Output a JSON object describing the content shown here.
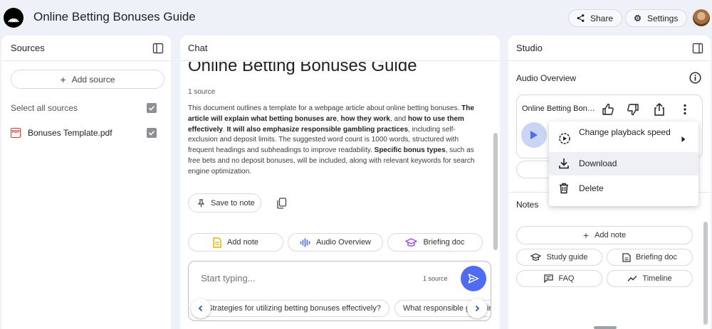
{
  "header": {
    "title": "Online Betting Bonuses Guide",
    "share_label": "Share",
    "settings_label": "Settings"
  },
  "sources": {
    "title": "Sources",
    "add_label": "Add source",
    "select_all_label": "Select all sources",
    "items": [
      {
        "name": "Bonuses Template.pdf",
        "badge": "PDF"
      }
    ]
  },
  "chat": {
    "title": "Chat",
    "doc_title": "Online Betting Bonuses Guide",
    "source_count": "1 source",
    "summary": [
      {
        "t": "This document outlines a template for a webpage article about online betting bonuses. ",
        "b": false
      },
      {
        "t": "The article will explain what betting bonuses are",
        "b": true
      },
      {
        "t": ", ",
        "b": false
      },
      {
        "t": "how they work",
        "b": true
      },
      {
        "t": ", and ",
        "b": false
      },
      {
        "t": "how to use them effectively",
        "b": true
      },
      {
        "t": ". ",
        "b": false
      },
      {
        "t": "It will also emphasize responsible gambling practices",
        "b": true
      },
      {
        "t": ", including self-exclusion and deposit limits. The suggested word count is 1000 words, structured with frequent headings and subheadings to improve readability. ",
        "b": false
      },
      {
        "t": "Specific bonus types",
        "b": true
      },
      {
        "t": ", such as free bets and no deposit bonuses, will be included, along with relevant keywords for search engine optimization.",
        "b": false
      }
    ],
    "save_note_label": "Save to note",
    "chips": {
      "add_note": "Add note",
      "audio_overview": "Audio Overview",
      "briefing_doc": "Briefing doc"
    },
    "composer": {
      "placeholder": "Start typing...",
      "source_count": "1 source"
    },
    "suggestions": [
      "Strategies for utilizing betting bonuses effectively?",
      "What responsible gambling practices are emphasized?"
    ]
  },
  "studio": {
    "title": "Studio",
    "audio_overview_title": "Audio Overview",
    "audio_card_title": "Online Betting Bonuses Guide",
    "notes_title": "Notes",
    "add_note_label": "Add note",
    "buttons": {
      "study_guide": "Study guide",
      "briefing_doc": "Briefing doc",
      "faq": "FAQ",
      "timeline": "Timeline"
    }
  },
  "menu": {
    "items": [
      {
        "label": "Change playback speed",
        "icon": "playback-speed-icon"
      },
      {
        "label": "Download",
        "icon": "download-icon"
      },
      {
        "label": "Delete",
        "icon": "trash-icon"
      }
    ]
  },
  "colors": {
    "page_bg": "#eef1f8",
    "accent": "#4f6cf0",
    "pdf_red": "#d93025",
    "play_bg": "#c9d5f3"
  }
}
